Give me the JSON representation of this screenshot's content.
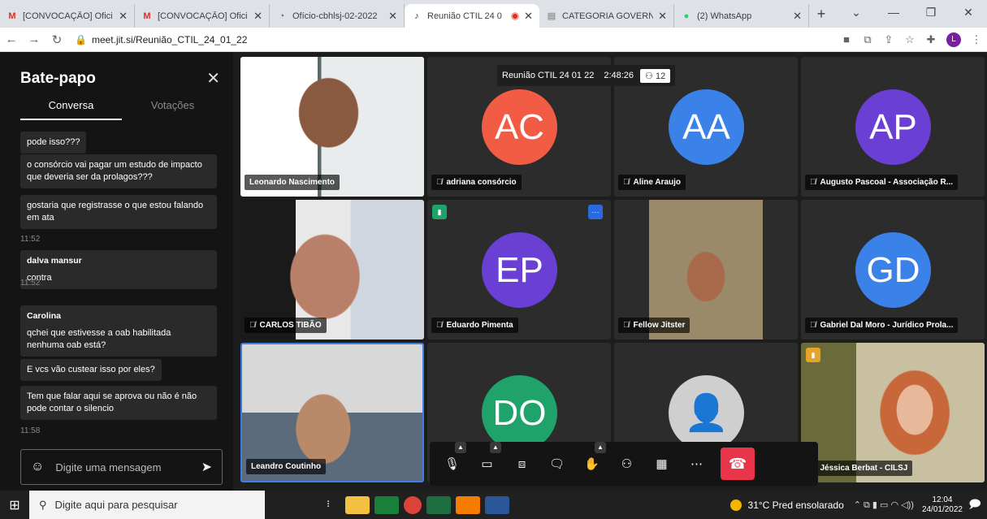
{
  "browser": {
    "tabs": [
      {
        "title": "[CONVOCAÇÃO] Ofici",
        "icon": "gmail-icon",
        "glyph": "M",
        "color": "#d93025"
      },
      {
        "title": "[CONVOCAÇÃO] Ofici",
        "icon": "gmail-icon",
        "glyph": "M",
        "color": "#d93025"
      },
      {
        "title": "Ofício-cbhlsj-02-2022",
        "icon": "globe-icon",
        "glyph": "◔",
        "color": "#5f6368"
      },
      {
        "title": "Reunião CTIL 24 0",
        "icon": "jitsi-icon",
        "glyph": "♪",
        "color": "#333"
      },
      {
        "title": "CATEGORIA GOVERNO",
        "icon": "sheet-icon",
        "glyph": "▤",
        "color": "#999"
      },
      {
        "title": "(2) WhatsApp",
        "icon": "whatsapp-icon",
        "glyph": "●",
        "color": "#25d366"
      }
    ],
    "url": "meet.jit.si/Reunião_CTIL_24_01_22",
    "profile_initial": "L"
  },
  "chat": {
    "title": "Bate-papo",
    "tabs": [
      "Conversa",
      "Votações"
    ],
    "messages": [
      {
        "text": "pode isso???"
      },
      {
        "text": "o consórcio vai pagar um estudo de impacto que deveria ser da prolagos???"
      },
      {
        "text": "gostaria que registrasse o que estou falando em ata"
      },
      {
        "time": "11:52"
      },
      {
        "sender": "dalva mansur",
        "text": "contra"
      },
      {
        "time": "11:52"
      },
      {
        "sender": "Carolina",
        "text": "qchei que estivesse a oab habilitada nenhuma oab está?"
      },
      {
        "text": "E vcs vão custear isso por eles?"
      },
      {
        "text": "Tem que falar aqui se aprova ou não é não pode contar o silencio"
      },
      {
        "time": "11:58"
      }
    ],
    "input_placeholder": "Digite uma mensagem"
  },
  "meeting": {
    "title": "Reunião CTIL 24 01 22",
    "elapsed": "2:48:26",
    "participant_count": "12",
    "logo": "jitsi",
    "participants": [
      {
        "name": "Leonardo Nascimento",
        "muted": false,
        "video": true,
        "photo": "photo-man-glasses-bg-white"
      },
      {
        "name": "adriana consórcio",
        "muted": true,
        "initials": "AC",
        "color": "#f25c45"
      },
      {
        "name": "Aline Araujo",
        "muted": true,
        "initials": "AA",
        "color": "#3b82e8"
      },
      {
        "name": "Augusto Pascoal - Associação R...",
        "muted": true,
        "initials": "AP",
        "color": "#6a3fd4"
      },
      {
        "name": "CARLOS TIBÃO",
        "muted": true,
        "video": true,
        "photo": "photo-bald-man-glasses"
      },
      {
        "name": "Eduardo Pimenta",
        "muted": true,
        "initials": "EP",
        "color": "#6a3fd4"
      },
      {
        "name": "Fellow Jitster",
        "muted": true,
        "video": true,
        "photo": "photo-woman-outdoor"
      },
      {
        "name": "Gabriel Dal Moro - Jurídico Prola...",
        "muted": true,
        "initials": "GD",
        "color": "#3b82e8"
      },
      {
        "name": "Leandro Coutinho",
        "muted": false,
        "video": true,
        "photo": "photo-man-grey-hair",
        "active": true
      },
      {
        "name": "",
        "muted": false,
        "initials": "DO",
        "color": "#1fa36a"
      },
      {
        "name": "",
        "muted": false,
        "placeholder": true
      },
      {
        "name": "Jéssica Berbat - CILSJ",
        "muted": true,
        "video": true,
        "photo": "photo-woman-red-hair"
      }
    ]
  },
  "taskbar": {
    "search_placeholder": "Digite aqui para pesquisar",
    "weather": "31°C  Pred ensolarado",
    "time": "12:04",
    "date": "24/01/2022"
  }
}
